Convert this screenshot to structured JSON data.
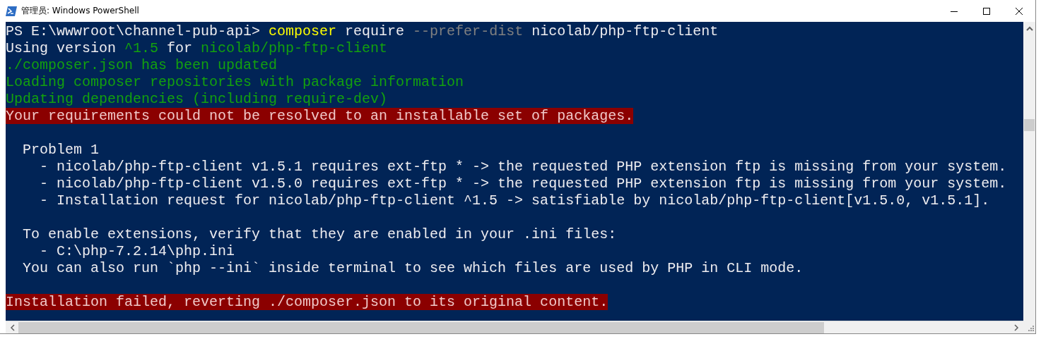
{
  "window": {
    "title": "管理员: Windows PowerShell"
  },
  "terminal": {
    "lines": [
      {
        "kind": "text",
        "segments": [
          {
            "text": "PS E:\\wwwroot\\channel-pub-api> ",
            "kind": "plain"
          },
          {
            "text": "composer",
            "kind": "command"
          },
          {
            "text": " require ",
            "kind": "plain"
          },
          {
            "text": "--prefer-dist",
            "kind": "param"
          },
          {
            "text": " nicolab/php-ftp-client",
            "kind": "plain"
          }
        ]
      },
      {
        "kind": "text",
        "segments": [
          {
            "text": "Using version ",
            "kind": "plain"
          },
          {
            "text": "^1.5",
            "kind": "info"
          },
          {
            "text": " for ",
            "kind": "plain"
          },
          {
            "text": "nicolab/php-ftp-client",
            "kind": "info"
          }
        ]
      },
      {
        "kind": "text",
        "segments": [
          {
            "text": "./composer.json has been updated",
            "kind": "info"
          }
        ]
      },
      {
        "kind": "text",
        "segments": [
          {
            "text": "Loading composer repositories with package information",
            "kind": "info"
          }
        ]
      },
      {
        "kind": "text",
        "segments": [
          {
            "text": "Updating dependencies (including require-dev)",
            "kind": "info"
          }
        ]
      },
      {
        "kind": "text",
        "segments": [
          {
            "text": "Your requirements could not be resolved to an installable set of packages.",
            "kind": "error"
          }
        ]
      },
      {
        "kind": "blank"
      },
      {
        "kind": "text",
        "segments": [
          {
            "text": "  Problem 1",
            "kind": "plain"
          }
        ]
      },
      {
        "kind": "text",
        "segments": [
          {
            "text": "    - nicolab/php-ftp-client v1.5.1 requires ext-ftp * -> the requested PHP extension ftp is missing from your system.",
            "kind": "plain"
          }
        ]
      },
      {
        "kind": "text",
        "segments": [
          {
            "text": "    - nicolab/php-ftp-client v1.5.0 requires ext-ftp * -> the requested PHP extension ftp is missing from your system.",
            "kind": "plain"
          }
        ]
      },
      {
        "kind": "text",
        "segments": [
          {
            "text": "    - Installation request for nicolab/php-ftp-client ^1.5 -> satisfiable by nicolab/php-ftp-client[v1.5.0, v1.5.1].",
            "kind": "plain"
          }
        ]
      },
      {
        "kind": "blank"
      },
      {
        "kind": "text",
        "segments": [
          {
            "text": "  To enable extensions, verify that they are enabled in your .ini files:",
            "kind": "plain"
          }
        ]
      },
      {
        "kind": "text",
        "segments": [
          {
            "text": "    - C:\\php-7.2.14\\php.ini",
            "kind": "plain"
          }
        ]
      },
      {
        "kind": "text",
        "segments": [
          {
            "text": "  You can also run `php --ini` inside terminal to see which files are used by PHP in CLI mode.",
            "kind": "plain"
          }
        ]
      },
      {
        "kind": "blank"
      },
      {
        "kind": "text",
        "segments": [
          {
            "text": "Installation failed, reverting ./composer.json to its original content.",
            "kind": "error"
          }
        ]
      }
    ]
  }
}
